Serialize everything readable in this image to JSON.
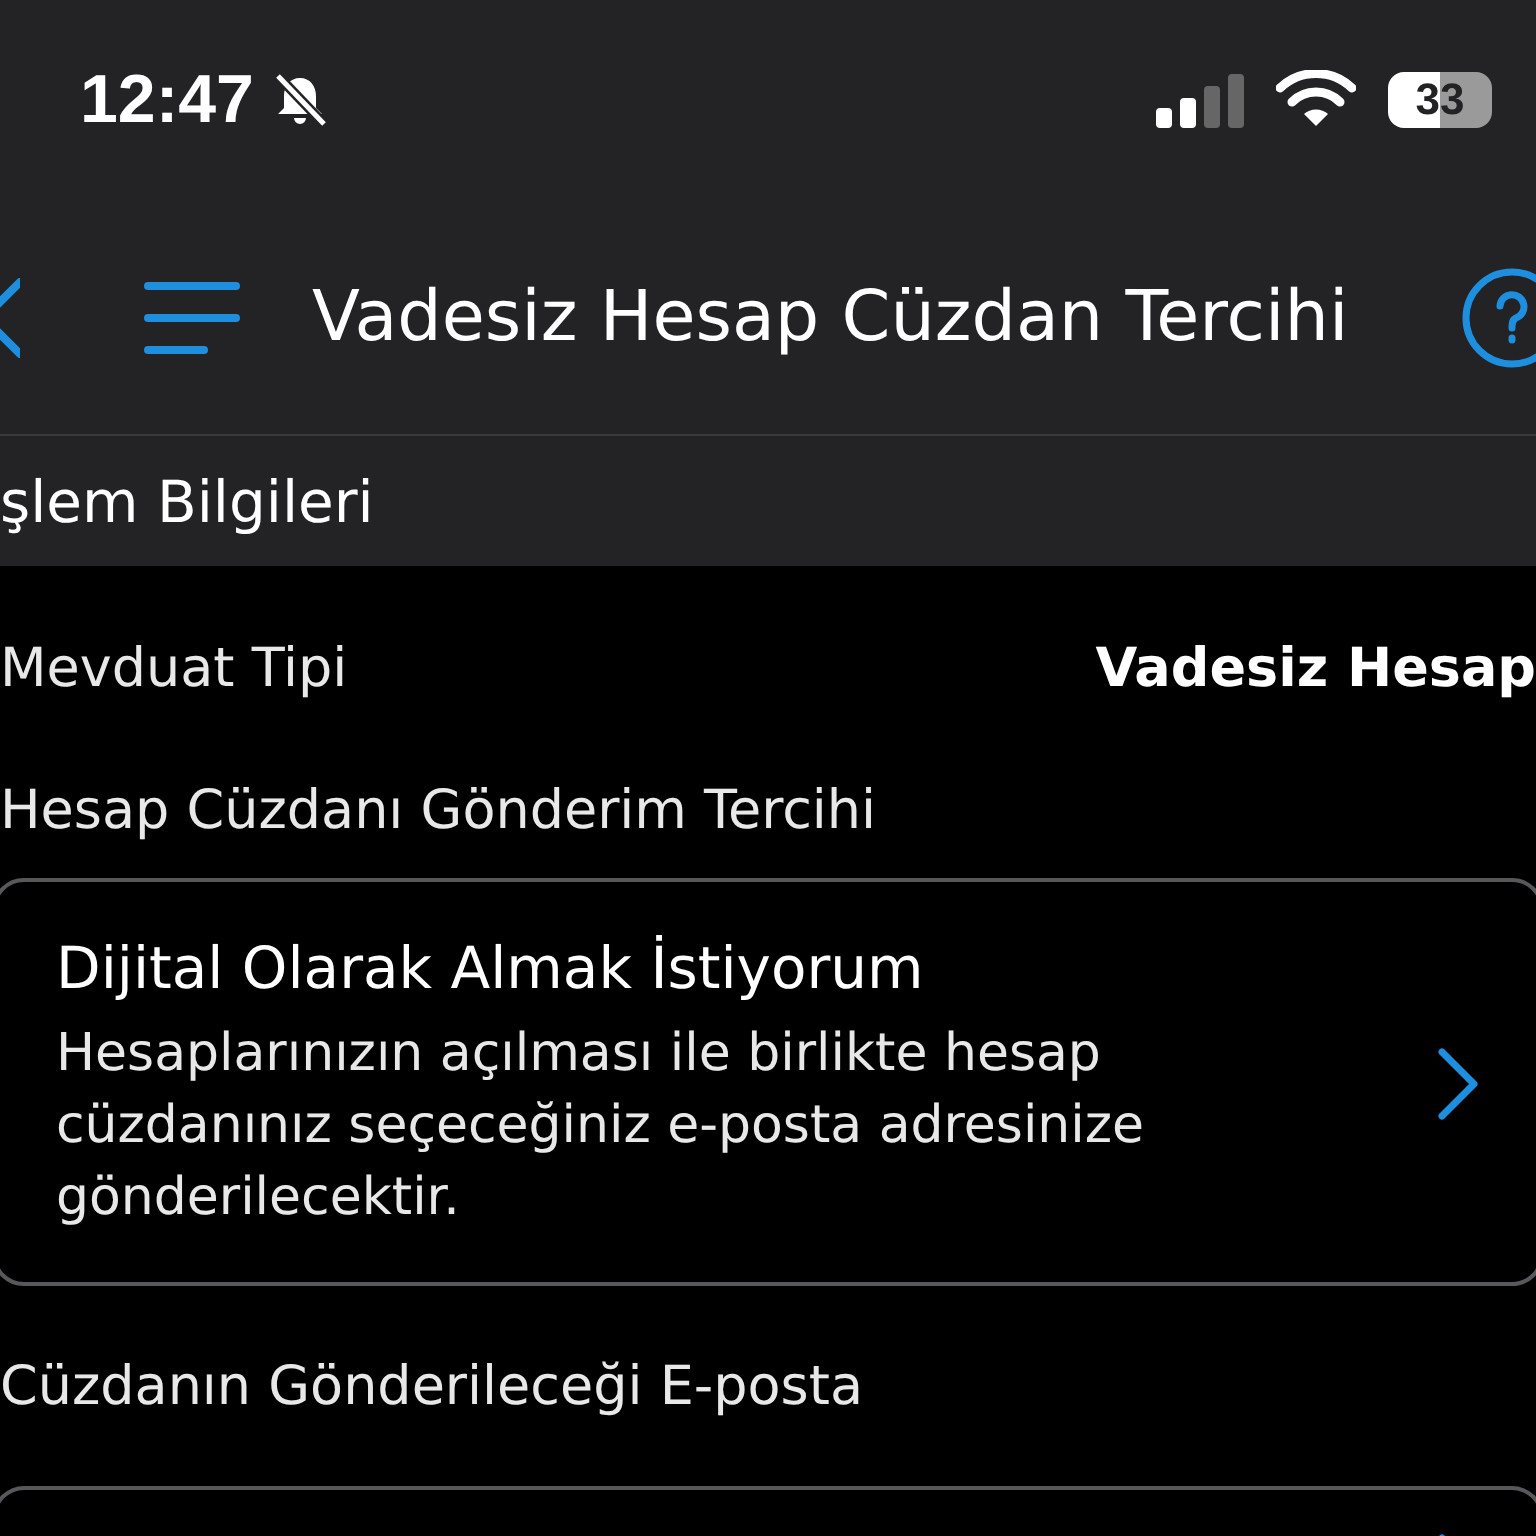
{
  "status_bar": {
    "time": "12:47",
    "battery": "33"
  },
  "nav": {
    "title": "Vadesiz Hesap Cüzdan Tercihi"
  },
  "section": {
    "title": "şlem Bilgileri"
  },
  "deposit": {
    "label": "Mevduat Tipi",
    "value": "Vadesiz Hesap"
  },
  "preference": {
    "label": "Hesap Cüzdanı Gönderim Tercihi",
    "title": "Dijital Olarak Almak İstiyorum",
    "description": "Hesaplarınızın açılması ile birlikte hesap cüzdanınız seçeceğiniz e-posta adresinize gönderilecektir."
  },
  "email": {
    "label": "Cüzdanın Gönderileceği E-posta"
  }
}
